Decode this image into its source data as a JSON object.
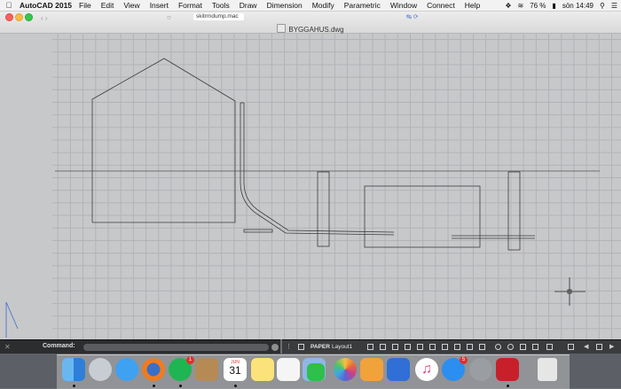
{
  "menubar": {
    "app_name": "AutoCAD 2015",
    "items": [
      "File",
      "Edit",
      "View",
      "Insert",
      "Format",
      "Tools",
      "Draw",
      "Dimension",
      "Modify",
      "Parametric",
      "Window",
      "Connect",
      "Help"
    ],
    "battery": "76 %",
    "clock": "sön 14:49"
  },
  "browser_preview": {
    "url": "skitrmdump.mac"
  },
  "window": {
    "title": "BYGGAHUS.dwg"
  },
  "command": {
    "label": "Command:",
    "value": ""
  },
  "statusbar": {
    "paper": "PAPER",
    "layout": "Layout1"
  },
  "dock": {
    "calendar_month": "JUN",
    "calendar_day": "31",
    "badges": {
      "spotify": "1",
      "appstore": "5"
    },
    "apps": [
      "Finder",
      "Launchpad",
      "Safari",
      "Firefox",
      "Spotify",
      "Contacts",
      "Calendar",
      "Notes",
      "Reminders",
      "Preview",
      "FaceTime",
      "Photos",
      "Pages",
      "Keynote",
      "iTunes",
      "App Store",
      "System Preferences",
      "AutoCAD",
      "Trash"
    ]
  },
  "colors": {
    "canvas": "#c7c8ca",
    "grid": "#b1b3b6",
    "drawing_line": "#3c3c3c",
    "command_bg": "#2c2d2f",
    "statusbar_bg": "#3a3b3d"
  }
}
